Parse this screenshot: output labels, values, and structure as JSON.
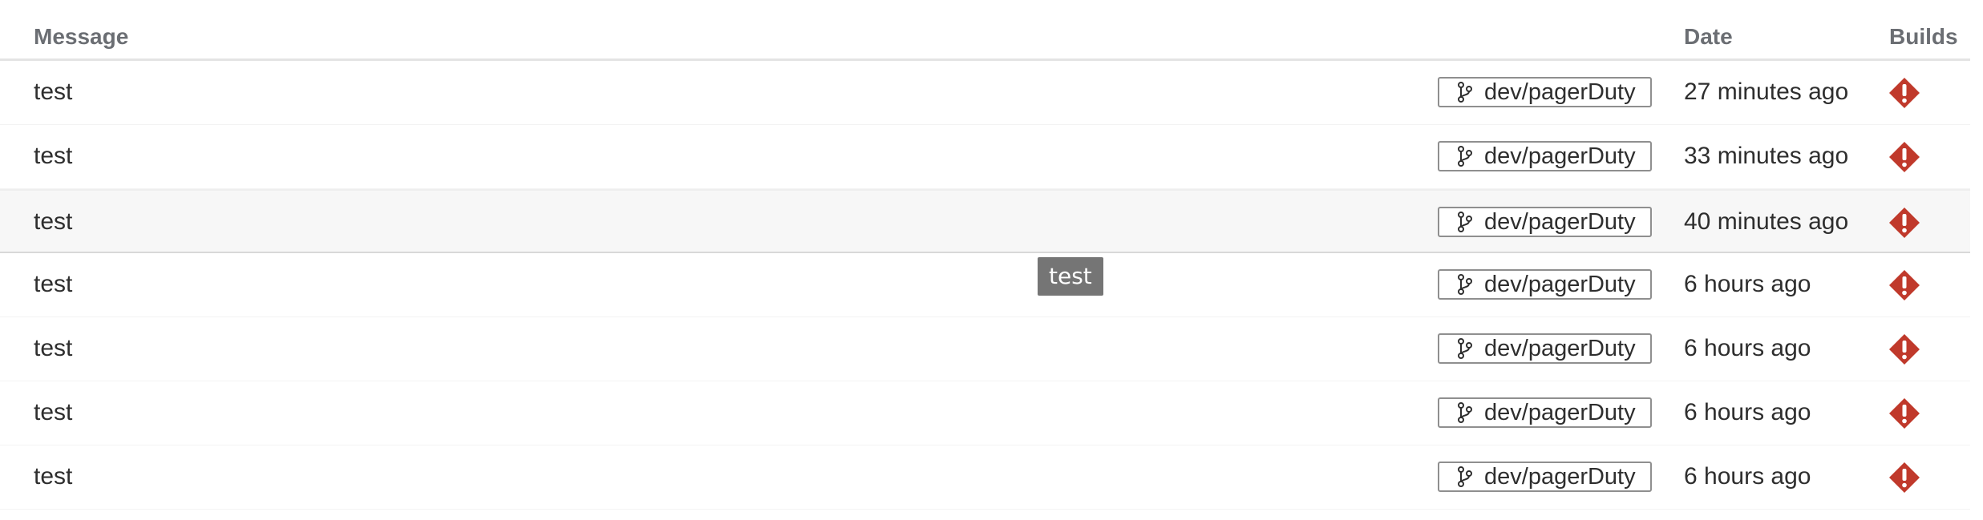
{
  "columns": {
    "message": "Message",
    "date": "Date",
    "builds": "Builds"
  },
  "status_color": "#c0392b",
  "rows": [
    {
      "message": "test",
      "branch": "dev/pagerDuty",
      "date": "27 minutes ago",
      "build_status": "failed"
    },
    {
      "message": "test",
      "branch": "dev/pagerDuty",
      "date": "33 minutes ago",
      "build_status": "failed"
    },
    {
      "message": "test",
      "branch": "dev/pagerDuty",
      "date": "40 minutes ago",
      "build_status": "failed"
    },
    {
      "message": "test",
      "branch": "dev/pagerDuty",
      "date": "6 hours ago",
      "build_status": "failed"
    },
    {
      "message": "test",
      "branch": "dev/pagerDuty",
      "date": "6 hours ago",
      "build_status": "failed"
    },
    {
      "message": "test",
      "branch": "dev/pagerDuty",
      "date": "6 hours ago",
      "build_status": "failed"
    },
    {
      "message": "test",
      "branch": "dev/pagerDuty",
      "date": "6 hours ago",
      "build_status": "failed"
    }
  ],
  "tooltip": {
    "text": "test"
  }
}
